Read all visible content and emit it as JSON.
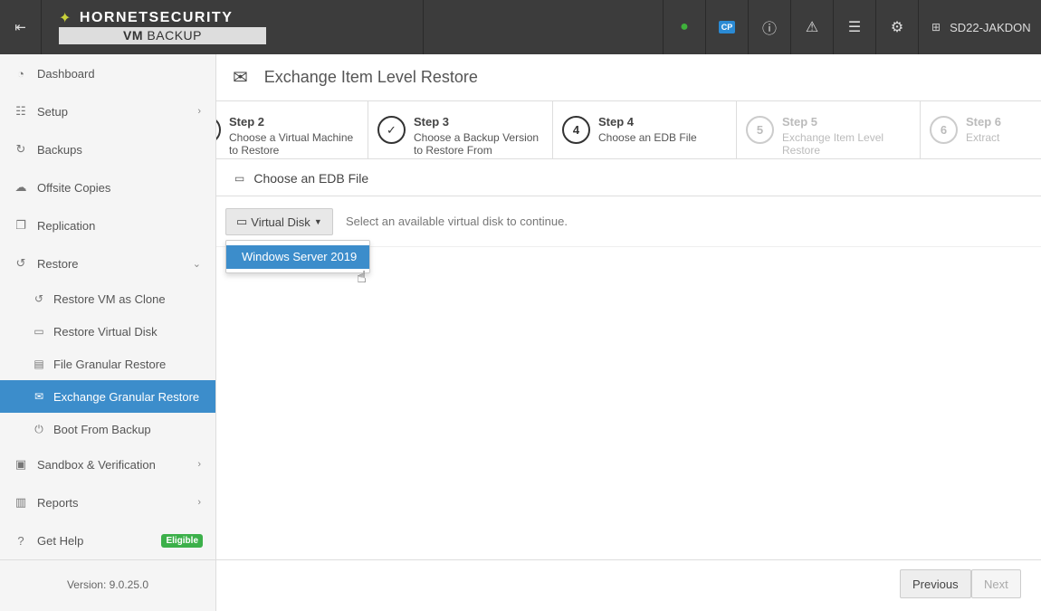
{
  "brand": {
    "name": "HORNETSECURITY",
    "product_vm": "VM",
    "product_backup": "BACKUP"
  },
  "topbar": {
    "user": "SD22-JAKDON",
    "cp_label": "CP"
  },
  "sidebar": {
    "items": [
      {
        "label": "Dashboard",
        "icon": "dashboard-icon"
      },
      {
        "label": "Setup",
        "icon": "sliders-icon"
      },
      {
        "label": "Backups",
        "icon": "refresh-icon"
      },
      {
        "label": "Offsite Copies",
        "icon": "cloud-upload-icon"
      },
      {
        "label": "Replication",
        "icon": "copy-icon"
      },
      {
        "label": "Restore",
        "icon": "undo-icon"
      },
      {
        "label": "Sandbox & Verification",
        "icon": "archive-icon"
      },
      {
        "label": "Reports",
        "icon": "bar-chart-icon"
      },
      {
        "label": "Get Help",
        "icon": "question-icon"
      }
    ],
    "restore_sub": [
      {
        "label": "Restore VM as Clone"
      },
      {
        "label": "Restore Virtual Disk"
      },
      {
        "label": "File Granular Restore"
      },
      {
        "label": "Exchange Granular Restore"
      },
      {
        "label": "Boot From Backup"
      }
    ],
    "help_badge": "Eligible",
    "version": "Version: 9.0.25.0"
  },
  "page": {
    "title": "Exchange Item Level Restore"
  },
  "wizard": {
    "steps": [
      {
        "title": "Step 2",
        "desc": "Choose a Virtual Machine to Restore",
        "state": "done"
      },
      {
        "title": "Step 3",
        "desc": "Choose a Backup Version to Restore From",
        "state": "done"
      },
      {
        "title": "Step 4",
        "num": "4",
        "desc": "Choose an EDB File",
        "state": "current"
      },
      {
        "title": "Step 5",
        "num": "5",
        "desc": "Exchange Item Level Restore",
        "state": "disabled"
      },
      {
        "title": "Step 6",
        "num": "6",
        "desc": "Extract",
        "state": "disabled"
      }
    ]
  },
  "section": {
    "title": "Choose an EDB File"
  },
  "toolbar": {
    "virtual_disk_label": "Virtual Disk",
    "hint": "Select an available virtual disk to continue.",
    "dropdown_options": [
      "Windows Server 2019"
    ]
  },
  "footer": {
    "previous": "Previous",
    "next": "Next"
  }
}
